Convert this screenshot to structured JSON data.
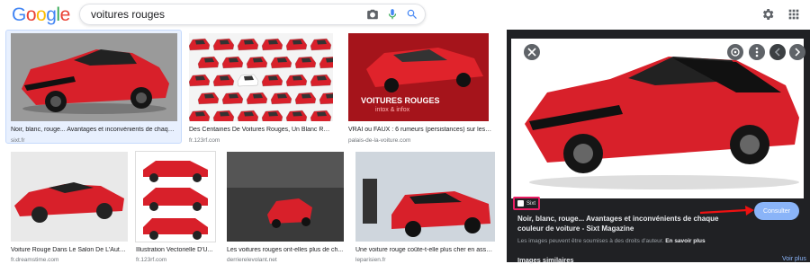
{
  "header": {
    "logo_letters": [
      "G",
      "o",
      "o",
      "g",
      "l",
      "e"
    ],
    "search_value": "voitures rouges"
  },
  "results": [
    {
      "title": "Noir, blanc, rouge... Avantages et inconvénients de chaque ...",
      "source": "sixt.fr"
    },
    {
      "title": "Des Centaines De Voitures Rouges, Un Blanc Réalis...",
      "source": "fr.123rf.com"
    },
    {
      "title": "VRAI ou FAUX : 6 rumeurs (persistances) sur les voit...",
      "source": "palais-de-la-voiture.com"
    },
    {
      "title": "Voiture Rouge Dans Le Salon De L'Auto ...",
      "source": "fr.dreamstime.com"
    },
    {
      "title": "Illustration Vectorielle D'U...",
      "source": "fr.123rf.com"
    },
    {
      "title": "Les voitures rouges ont-elles plus de ch...",
      "source": "derrierelevolant.net"
    },
    {
      "title": "Une voiture rouge coûte-t-elle plus cher en assur...",
      "source": "leparisien.fr"
    }
  ],
  "overlay_texts": {
    "vrai_title": "VOITURES ROUGES",
    "vrai_sub": "intox & infox"
  },
  "panel": {
    "source_label": "Sixt",
    "title": "Noir, blanc, rouge... Avantages et inconvénients de chaque couleur de voiture - Sixt Magazine",
    "note": "Les images peuvent être soumises à des droits d'auteur.",
    "learn_more": "En savoir plus",
    "consult_label": "Consulter",
    "similar_label": "Images similaires",
    "see_all_label": "Voir plus"
  },
  "colors": {
    "accent": "#8ab4f8",
    "highlight": "#e91e63",
    "panel_bg": "#202124",
    "car_red": "#d8202a"
  }
}
